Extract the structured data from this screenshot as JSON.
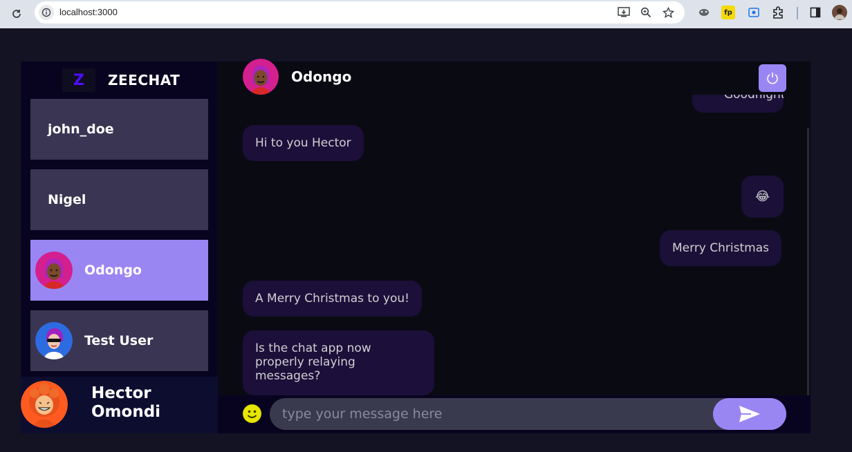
{
  "browser": {
    "url": "localhost:3000"
  },
  "brand": {
    "logo_letter": "Z",
    "name": "ZEECHAT"
  },
  "contacts": [
    {
      "name": "john_doe",
      "has_avatar": false
    },
    {
      "name": "Nigel",
      "has_avatar": false
    },
    {
      "name": "Odongo",
      "has_avatar": true,
      "selected": true
    },
    {
      "name": "Test User",
      "has_avatar": true
    }
  ],
  "current_user": {
    "name": "Hector Omondi"
  },
  "chat": {
    "header_name": "Odongo",
    "messages": [
      {
        "text": "Goodnight",
        "direction": "sent",
        "partial": true
      },
      {
        "text": "Hi to you Hector",
        "direction": "received"
      },
      {
        "text": "😂",
        "direction": "sent"
      },
      {
        "text": "Merry Christmas",
        "direction": "sent"
      },
      {
        "text": "A Merry Christmas to you!",
        "direction": "received"
      },
      {
        "text": "Is the chat app now properly relaying messages?",
        "direction": "received"
      }
    ],
    "input_placeholder": "type your message here"
  },
  "colors": {
    "accent": "#9a86f3",
    "brand": "#4e0eff",
    "bubble": "#1c0f3a",
    "sidebar_item": "#3a3552"
  }
}
